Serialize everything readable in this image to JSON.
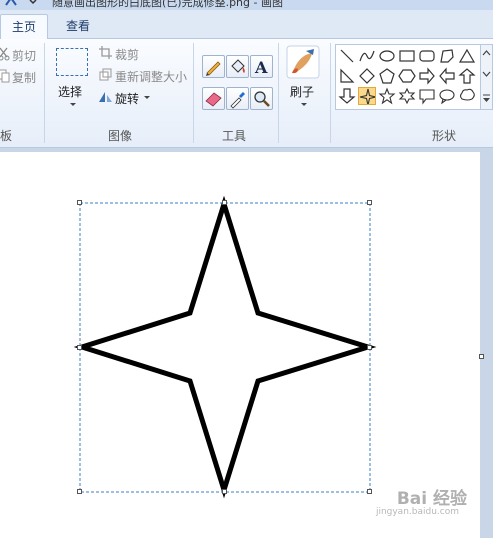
{
  "title_bar": {
    "title": "随意画出图形的白底图(已)完成修整.png - 画图"
  },
  "tabs": [
    {
      "label": "主页"
    },
    {
      "label": "查看"
    }
  ],
  "clipboard": {
    "cut_label": "剪切",
    "copy_label": "复制",
    "group_label": "板"
  },
  "image": {
    "select_label": "选择",
    "crop_label": "裁剪",
    "resize_label": "重新调整大小",
    "rotate_label": "旋转",
    "group_label": "图像"
  },
  "tools": {
    "group_label": "工具"
  },
  "brushes": {
    "label": "刷子"
  },
  "shapes": {
    "group_label": "形状"
  },
  "watermark": {
    "text": "Bai 经验",
    "url": "jingyan.baidu.com"
  },
  "colors": {
    "accent": "#1c6fd1",
    "ribbon": "#e6eef9",
    "selection": "#fbd98a"
  }
}
